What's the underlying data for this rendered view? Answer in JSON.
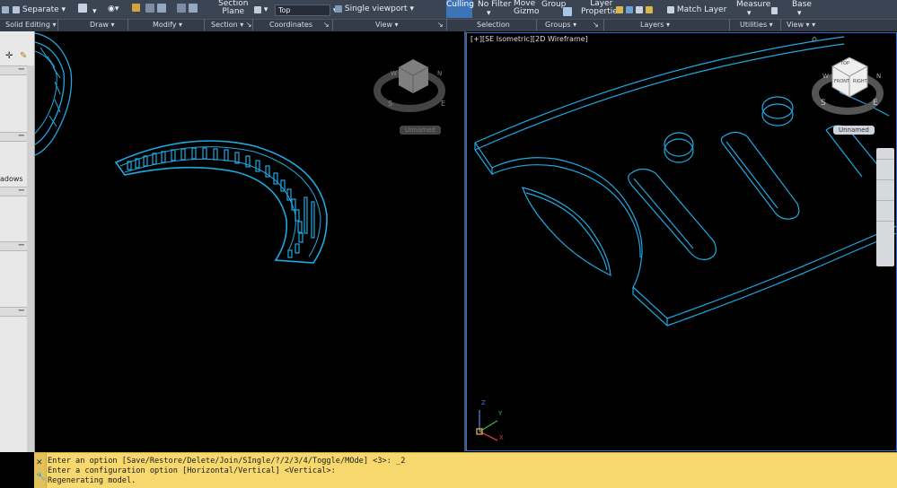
{
  "ribbon": {
    "buttons": {
      "separate": "Separate",
      "section_plane": [
        "Section",
        "Plane"
      ],
      "view_top": "Top",
      "single_viewport": "Single viewport",
      "culling": "Culling",
      "no_filter": "No Filter",
      "move_gizmo": [
        "Move",
        "Gizmo"
      ],
      "group": "Group",
      "layer_properties": [
        "Layer",
        "Properties"
      ],
      "match_layer": "Match Layer",
      "measure": "Measure",
      "base": "Base"
    },
    "panels": [
      {
        "label": "Solid Editing ▾"
      },
      {
        "label": "Draw ▾"
      },
      {
        "label": "Modify ▾"
      },
      {
        "label": "Section ▾ ↘"
      },
      {
        "label": "Coordinates"
      },
      {
        "label": "↘"
      },
      {
        "label": "View ▾"
      },
      {
        "label": "↘"
      },
      {
        "label": "Selection"
      },
      {
        "label": "Groups ▾"
      },
      {
        "label": "↘"
      },
      {
        "label": "Layers ▾"
      },
      {
        "label": "Utilities ▾"
      },
      {
        "label": "View ▾ ▾"
      }
    ]
  },
  "left_palette": {
    "shadows_label": "adows"
  },
  "viewport_left": {
    "unnamed": "Unnamed",
    "viewcube_compass": {
      "n": "N",
      "w": "W",
      "e": "E",
      "s": "S"
    }
  },
  "viewport_right": {
    "label": "[+][SE Isometric][2D Wireframe]",
    "unnamed": "Unnamed",
    "viewcube_faces": {
      "top": "TOP",
      "front": "FRONT",
      "right": "RIGHT"
    },
    "viewcube_compass": {
      "n": "N",
      "w": "W",
      "e": "E",
      "s": "S"
    },
    "ucs": {
      "x": "X",
      "y": "Y",
      "z": "Z"
    }
  },
  "command_line": {
    "lines": [
      "Enter an option [Save/Restore/Delete/Join/SIngle/?/2/3/4/Toggle/MOde] <3>: _2",
      "Enter a configuration option [Horizontal/Vertical] <Vertical>:",
      "Regenerating model."
    ]
  },
  "colors": {
    "ribbon_bg": "#3b4453",
    "accent": "#3c74b7",
    "geometry": "#1fa9e1",
    "command_bg": "#f6d86e"
  }
}
